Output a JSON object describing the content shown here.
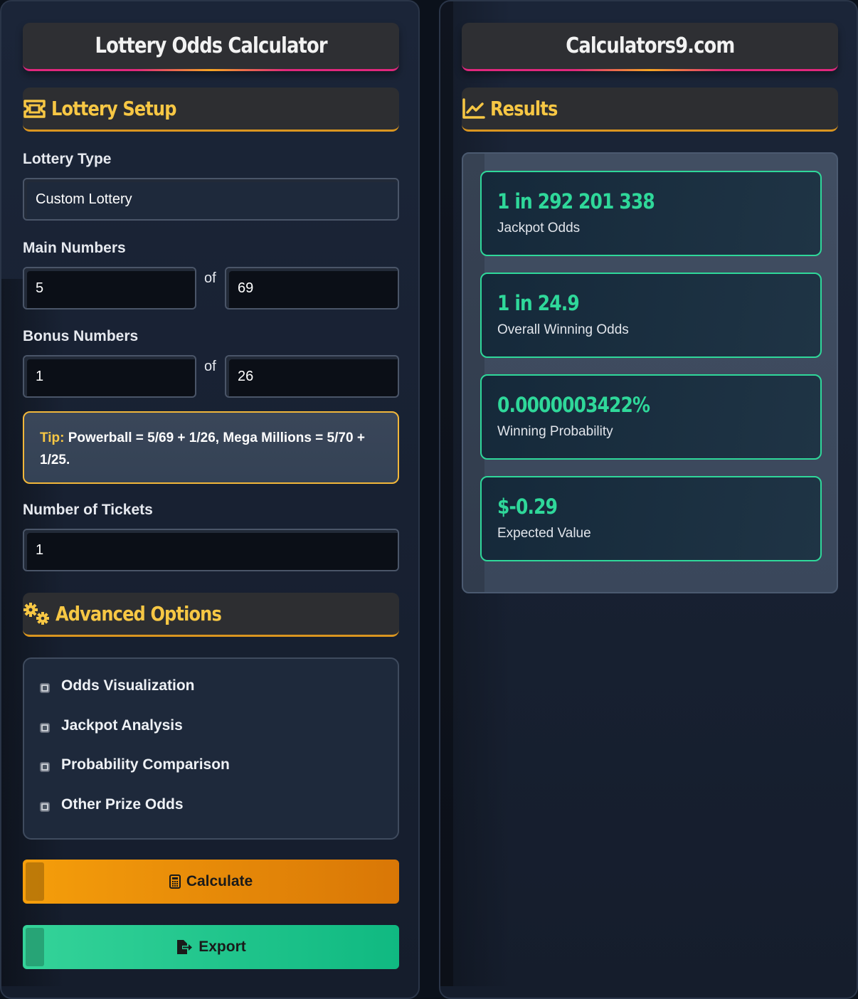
{
  "left": {
    "title": "Lottery Odds Calculator",
    "setup_heading": "Lottery Setup",
    "lottery_type_label": "Lottery Type",
    "lottery_type_value": "Custom Lottery",
    "main_numbers_label": "Main Numbers",
    "main_pick": "5",
    "main_of": "of",
    "main_pool": "69",
    "bonus_numbers_label": "Bonus Numbers",
    "bonus_pick": "1",
    "bonus_of": "of",
    "bonus_pool": "26",
    "tip_label": "Tip:",
    "tip_text": " Powerball = 5/69 + 1/26, Mega Millions = 5/70 + 1/25.",
    "tickets_label": "Number of Tickets",
    "tickets_value": "1",
    "advanced_heading": "Advanced Options",
    "options": [
      {
        "label": "Odds Visualization",
        "checked": false
      },
      {
        "label": "Jackpot Analysis",
        "checked": false
      },
      {
        "label": "Probability Comparison",
        "checked": false
      },
      {
        "label": "Other Prize Odds",
        "checked": false
      }
    ],
    "calculate_label": "Calculate",
    "export_label": "Export"
  },
  "right": {
    "title": "Calculators9.com",
    "results_heading": "Results",
    "results": [
      {
        "value": "1 in 292 201 338",
        "label": "Jackpot Odds"
      },
      {
        "value": "1 in 24.9",
        "label": "Overall Winning Odds"
      },
      {
        "value": "0.0000003422%",
        "label": "Winning Probability"
      },
      {
        "value": "$-0.29",
        "label": "Expected Value"
      }
    ]
  },
  "colors": {
    "accent_gold": "#f7c744",
    "accent_pink": "#e0287d",
    "result_green": "#2fd89a",
    "calculate_orange": "#f59e0b",
    "export_green": "#10b981"
  },
  "icons": [
    "ticket-icon",
    "gears-icon",
    "chart-line-icon",
    "calculator-icon",
    "file-export-icon",
    "checkbox-icon"
  ]
}
